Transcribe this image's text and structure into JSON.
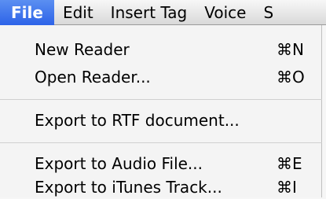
{
  "menubar": {
    "items": [
      "File",
      "Edit",
      "Insert Tag",
      "Voice",
      "S"
    ]
  },
  "file_menu": {
    "items": [
      {
        "label": "New Reader",
        "shortcut": "⌘N"
      },
      {
        "label": "Open Reader...",
        "shortcut": "⌘O"
      },
      {
        "label": "Export to RTF document...",
        "shortcut": ""
      },
      {
        "label": "Export to Audio File...",
        "shortcut": "⌘E"
      },
      {
        "label": "Export to iTunes Track...",
        "shortcut": "⌘I"
      }
    ]
  }
}
